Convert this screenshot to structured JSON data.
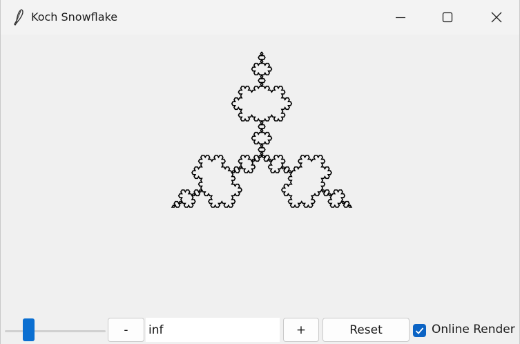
{
  "window": {
    "title": "Koch Snowflake",
    "icon": "feather-icon",
    "controls": [
      "minimize-icon",
      "maximize-icon",
      "close-icon"
    ]
  },
  "canvas": {
    "figure": "koch-snowflake",
    "stroke_color": "#000000",
    "background": "#f0f0f0"
  },
  "toolbar": {
    "slider_level": 0.2,
    "decrease_label": "-",
    "iterations_value": "inf",
    "increase_label": "+",
    "reset_label": "Reset",
    "online_render": {
      "label": "Online Render",
      "checked": true
    }
  },
  "colors": {
    "accent": "#0b6fd1",
    "titlebar": "#f3f3f3",
    "window": "#f0f0f0"
  }
}
